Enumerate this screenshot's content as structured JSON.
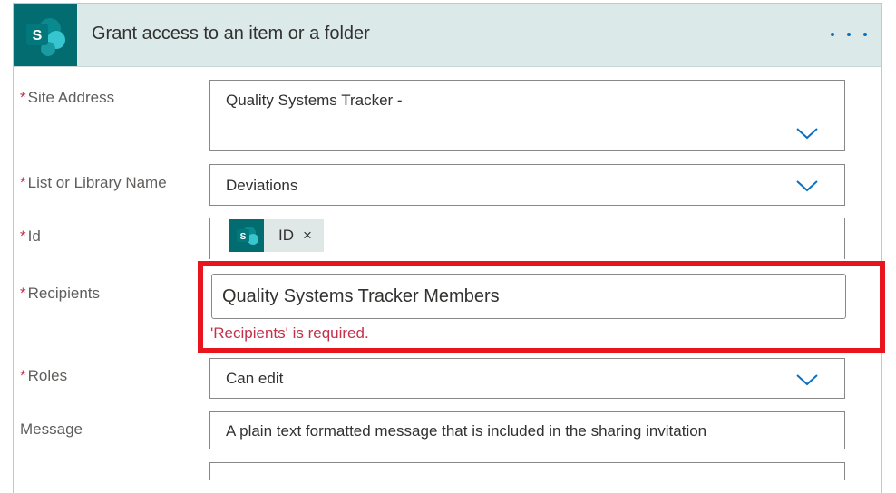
{
  "card": {
    "title": "Grant access to an item or a folder",
    "app_icon": "sharepoint-icon",
    "more_icon": "more-options-icon"
  },
  "fields": {
    "site_address": {
      "label": "Site Address",
      "required_marker": "*",
      "value": "Quality Systems Tracker -"
    },
    "list_name": {
      "label": "List or Library Name",
      "required_marker": "*",
      "value": "Deviations"
    },
    "id": {
      "label": "Id",
      "required_marker": "*",
      "token_label": "ID",
      "token_remove": "×"
    },
    "recipients": {
      "label": "Recipients",
      "required_marker": "*",
      "value": "Quality Systems Tracker Members",
      "error": "'Recipients' is required."
    },
    "roles": {
      "label": "Roles",
      "required_marker": "*",
      "value": "Can edit"
    },
    "message": {
      "label": "Message",
      "placeholder": "A plain text formatted message that is included in the sharing invitation"
    }
  },
  "colors": {
    "accent": "#0b6fc4",
    "sharepoint": "#036c70",
    "header_bg": "#dbe9e9",
    "error": "#c4314b",
    "highlight": "#e8141e"
  }
}
